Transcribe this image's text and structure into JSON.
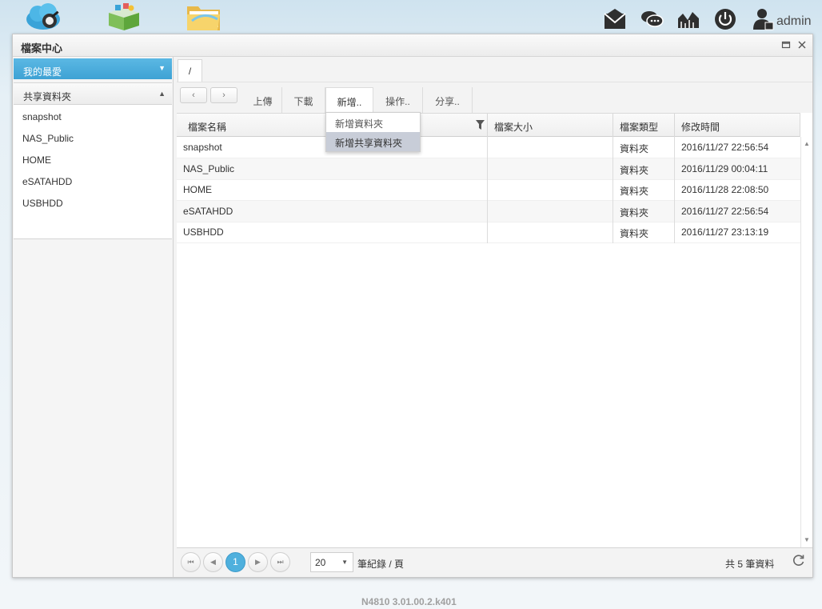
{
  "topbar": {
    "apps": [
      {
        "icon": "cloud-drive-icon"
      },
      {
        "icon": "app-center-icon"
      },
      {
        "icon": "file-folder-icon"
      }
    ],
    "system_icons": [
      "message-icon",
      "chat-icon",
      "resource-monitor-icon",
      "power-icon",
      "user-icon"
    ],
    "user_name": "admin"
  },
  "window": {
    "title": "檔案中心"
  },
  "sidebar": {
    "favorites_label": "我的最愛",
    "shared_label": "共享資料夾",
    "shares": [
      "snapshot",
      "NAS_Public",
      "HOME",
      "eSATAHDD",
      "USBHDD"
    ]
  },
  "pathbar": {
    "crumb": "/"
  },
  "toolbar": {
    "back": "‹",
    "forward": "›",
    "upload": "上傳",
    "download": "下載",
    "new": "新增..",
    "operations": "操作..",
    "share": "分享.."
  },
  "new_menu": {
    "items": [
      "新增資料夾",
      "新增共享資料夾"
    ]
  },
  "grid": {
    "headers": {
      "name": "檔案名稱",
      "size": "檔案大小",
      "type": "檔案類型",
      "time": "修改時間"
    },
    "rows": [
      {
        "name": "snapshot",
        "size": "",
        "type": "資料夾",
        "time": "2016/11/27 22:56:54"
      },
      {
        "name": "NAS_Public",
        "size": "",
        "type": "資料夾",
        "time": "2016/11/29 00:04:11"
      },
      {
        "name": "HOME",
        "size": "",
        "type": "資料夾",
        "time": "2016/11/28 22:08:50"
      },
      {
        "name": "eSATAHDD",
        "size": "",
        "type": "資料夾",
        "time": "2016/11/27 22:56:54"
      },
      {
        "name": "USBHDD",
        "size": "",
        "type": "資料夾",
        "time": "2016/11/27 23:13:19"
      }
    ]
  },
  "pager": {
    "current_page": "1",
    "page_size": "20",
    "per_page_label": "筆紀錄 / 頁",
    "total_label": "共 5 筆資料"
  },
  "footer": {
    "version": "N4810   3.01.00.2.k401"
  },
  "colors": {
    "accent": "#4fb0dd",
    "menu_hover": "#c8cdd8"
  }
}
